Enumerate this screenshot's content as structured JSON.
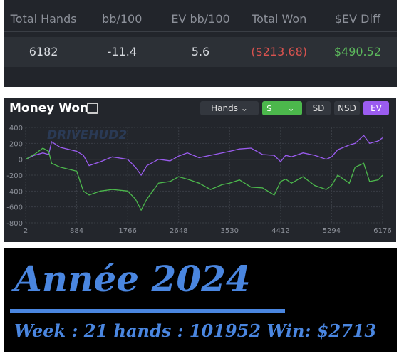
{
  "stats": {
    "headers": [
      "Total Hands",
      "bb/100",
      "EV bb/100",
      "Total Won",
      "$EV Diff"
    ],
    "values": [
      "6182",
      "-11.4",
      "5.6",
      "($213.68)",
      "$490.52"
    ],
    "colors": [
      "#d8dbe0",
      "#d8dbe0",
      "#d8dbe0",
      "#d9534f",
      "#5cb85c"
    ]
  },
  "panel": {
    "title": "Money Won",
    "external_icon": "external-link-icon",
    "hands_select": "Hands",
    "currency_select": "$",
    "buttons": [
      "SD",
      "NSD",
      "EV"
    ],
    "watermark": "DRIVEHUD2",
    "accent_green": "#4cb84c",
    "accent_purple": "#9b5cf0"
  },
  "chart_data": {
    "type": "line",
    "xlabel": "",
    "ylabel": "",
    "ylim": [
      -800,
      400
    ],
    "xlim": [
      2,
      6176
    ],
    "yticks": [
      "400",
      "200",
      "0",
      "-200",
      "-400",
      "-600",
      "-800"
    ],
    "xticks": [
      "2",
      "884",
      "1766",
      "2648",
      "3530",
      "4412",
      "5294",
      "6176"
    ],
    "grid": true,
    "x": [
      2,
      150,
      300,
      400,
      450,
      600,
      884,
      1000,
      1100,
      1300,
      1500,
      1766,
      1900,
      2000,
      2100,
      2300,
      2500,
      2648,
      2800,
      3000,
      3200,
      3400,
      3530,
      3700,
      3900,
      4100,
      4300,
      4412,
      4500,
      4600,
      4800,
      5000,
      5200,
      5294,
      5400,
      5600,
      5700,
      5850,
      5950,
      6100,
      6176
    ],
    "series": [
      {
        "color": "#9b5cf0",
        "values": [
          0,
          50,
          80,
          60,
          220,
          150,
          100,
          50,
          -80,
          -30,
          30,
          0,
          -100,
          -200,
          -80,
          0,
          -20,
          40,
          80,
          20,
          50,
          80,
          100,
          130,
          140,
          60,
          50,
          -30,
          50,
          30,
          80,
          50,
          0,
          30,
          120,
          180,
          200,
          300,
          200,
          230,
          270
        ]
      },
      {
        "color": "#4cb84c",
        "values": [
          0,
          60,
          140,
          100,
          -50,
          -100,
          -150,
          -400,
          -450,
          -400,
          -380,
          -400,
          -500,
          -640,
          -500,
          -300,
          -280,
          -220,
          -250,
          -300,
          -380,
          -320,
          -300,
          -260,
          -350,
          -360,
          -450,
          -280,
          -250,
          -300,
          -220,
          -330,
          -380,
          -330,
          -200,
          -300,
          -100,
          -50,
          -280,
          -260,
          -200
        ]
      }
    ]
  },
  "banner": {
    "title": "Année 2024",
    "subtitle": "Week :  21 hands : 101952 Win: $2713"
  }
}
